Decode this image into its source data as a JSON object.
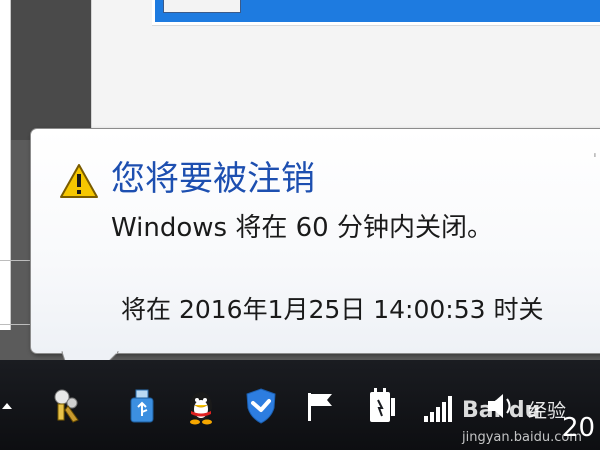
{
  "notification": {
    "title": "您将要被注销",
    "message": "Windows 将在 60 分钟内关闭。",
    "detail": "将在 2016年1月25日 14:00:53 时关",
    "icon": "warning-icon",
    "title_color": "#1d4fb0"
  },
  "taskbar": {
    "tray_icons": [
      "network-config-icon",
      "usb-drive-icon",
      "qq-penguin-icon",
      "security-shield-icon",
      "action-center-flag-icon",
      "power-plug-icon",
      "signal-bars-icon",
      "speaker-icon"
    ],
    "clock_partial": "20"
  },
  "watermark": {
    "logo": "Bai du",
    "label": "经验",
    "url": "jingyan.baidu.com"
  }
}
